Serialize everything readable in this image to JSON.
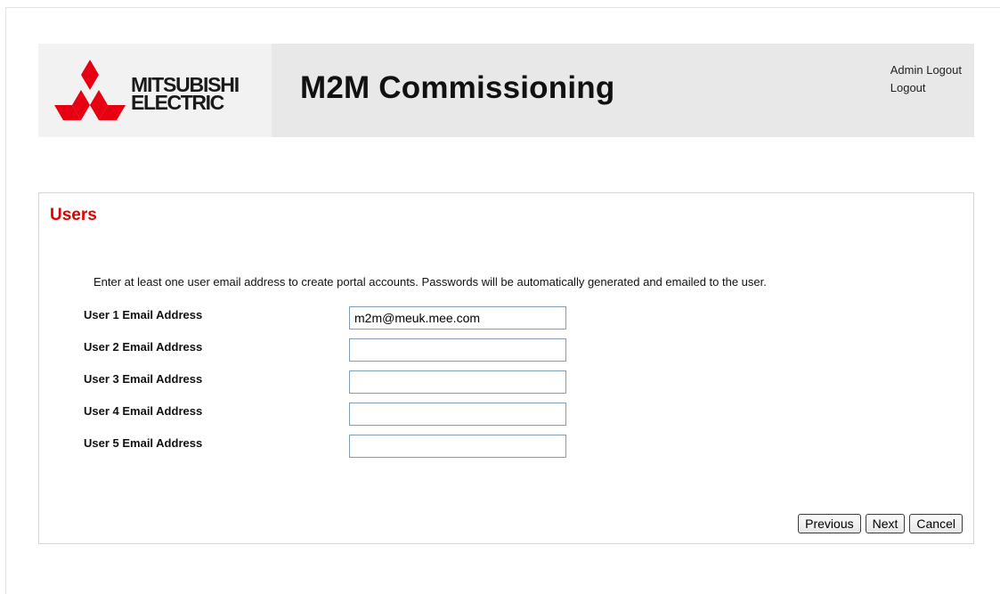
{
  "header": {
    "logo_line1": "MITSUBISHI",
    "logo_line2": "ELECTRIC",
    "app_title": "M2M Commissioning",
    "links": [
      "Admin Logout",
      "Logout"
    ],
    "logo_color": "#e60012"
  },
  "users": {
    "title": "Users",
    "instructions": "Enter at least one user email address to create portal accounts. Passwords will be automatically generated and emailed to the user.",
    "fields": [
      {
        "label": "User 1 Email Address",
        "value": "m2m@meuk.mee.com"
      },
      {
        "label": "User 2 Email Address",
        "value": ""
      },
      {
        "label": "User 3 Email Address",
        "value": ""
      },
      {
        "label": "User 4 Email Address",
        "value": ""
      },
      {
        "label": "User 5 Email Address",
        "value": ""
      }
    ],
    "buttons": {
      "previous": "Previous",
      "next": "Next",
      "cancel": "Cancel"
    },
    "title_color": "#e00000"
  }
}
